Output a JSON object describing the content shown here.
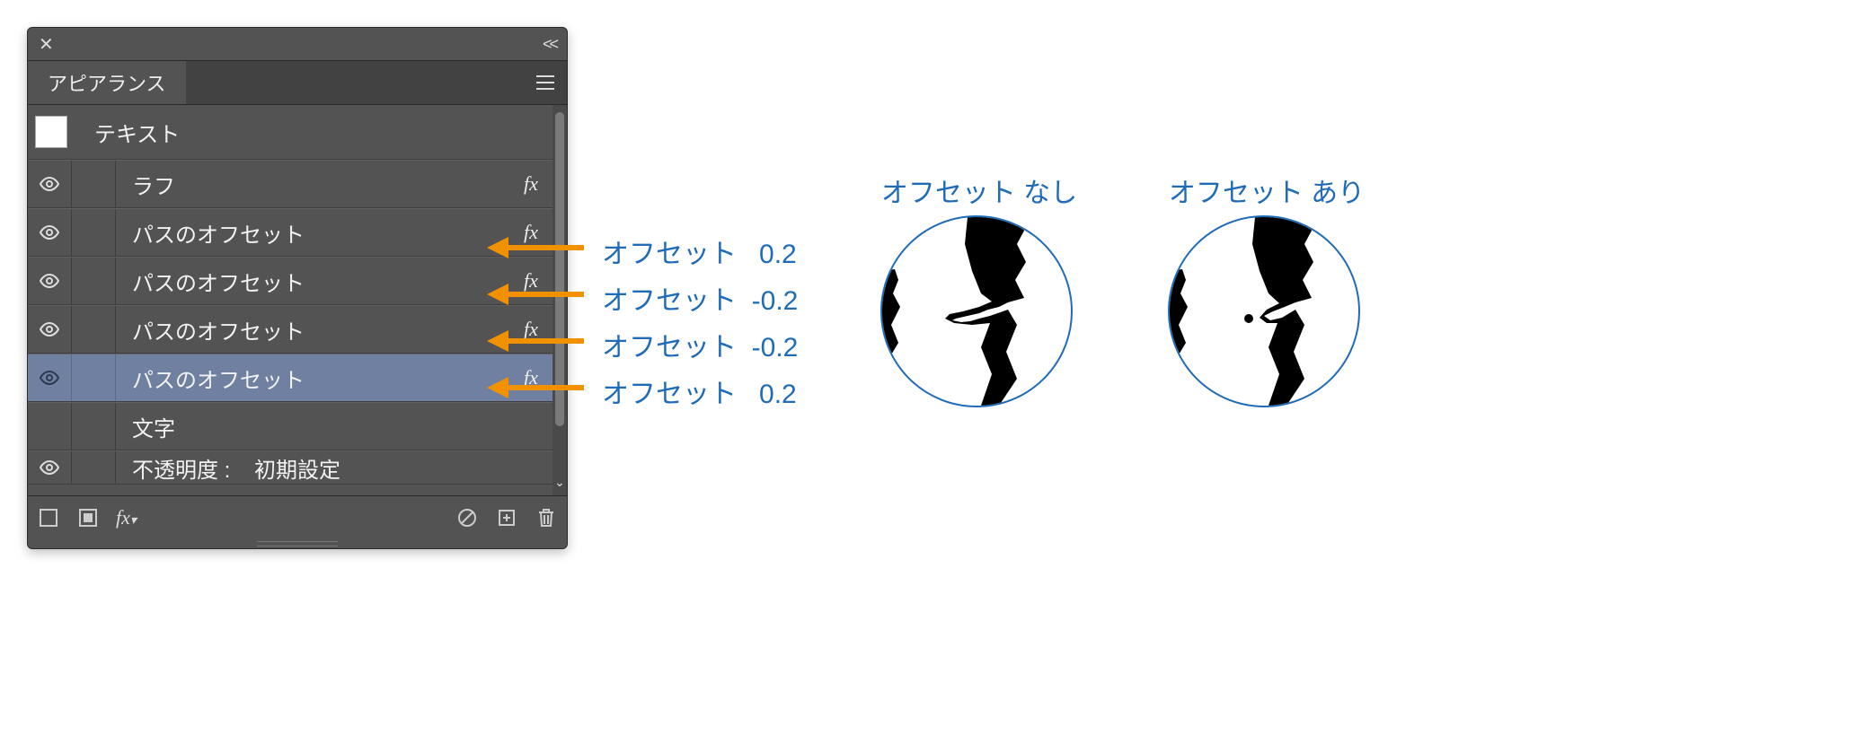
{
  "panel": {
    "tab": "アピアランス",
    "rows": [
      {
        "kind": "header",
        "label": "テキスト"
      },
      {
        "kind": "fx",
        "label": "ラフ",
        "eye": true,
        "fx": "fx",
        "dashed": false
      },
      {
        "kind": "fx",
        "label": "パスのオフセット",
        "eye": true,
        "fx": "fx",
        "dashed": true
      },
      {
        "kind": "fx",
        "label": "パスのオフセット",
        "eye": true,
        "fx": "fx",
        "dashed": true
      },
      {
        "kind": "fx",
        "label": "パスのオフセット",
        "eye": true,
        "fx": "fx",
        "dashed": true
      },
      {
        "kind": "fx",
        "label": "パスのオフセット",
        "eye": true,
        "fx": "fx",
        "dashed": true,
        "selected": true
      },
      {
        "kind": "plain",
        "label": "文字"
      },
      {
        "kind": "opacity",
        "label": "不透明度 :",
        "value": "初期設定",
        "eye": true,
        "dashed": true
      }
    ],
    "footer_fx": "fx"
  },
  "annotations": [
    {
      "text": "オフセット   0.2"
    },
    {
      "text": "オフセット  -0.2"
    },
    {
      "text": "オフセット  -0.2"
    },
    {
      "text": "オフセット   0.2"
    }
  ],
  "previews": {
    "left_title": "オフセット なし",
    "right_title": "オフセット あり"
  }
}
